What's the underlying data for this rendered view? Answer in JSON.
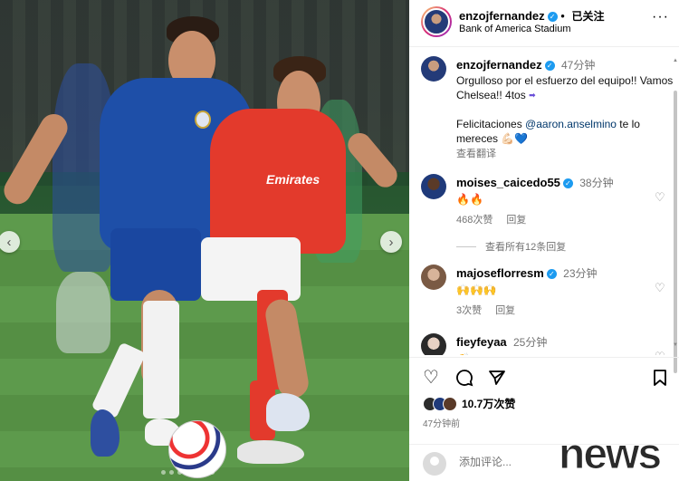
{
  "header": {
    "username": "enzojfernandez",
    "verified_icon": "verified-badge-icon",
    "separator": "•",
    "follow_status": "已关注",
    "location": "Bank of America Stadium",
    "more_icon": "more-horizontal-icon"
  },
  "photo": {
    "sponsor_text": "Emirates",
    "prev_icon": "chevron-left-icon",
    "next_icon": "chevron-right-icon",
    "active_slide": 4,
    "total_slides": 7
  },
  "caption": {
    "username": "enzojfernandez",
    "time": "47分钟",
    "text_line1": "Orgulloso por el esfuerzo del equipo!! Vamos Chelsea!! 4tos",
    "soon_icon": "soon-arrow-icon",
    "text_line2_prefix": "Felicitaciones",
    "mention": "@aaron.anselmino",
    "text_line2_suffix": "te lo mereces",
    "emoji": "💪🏻💙",
    "translate": "查看翻译"
  },
  "comments": [
    {
      "username": "moises_caicedo55",
      "time": "38分钟",
      "text": "🔥🔥",
      "likes": "468次赞",
      "reply": "回复"
    },
    {
      "username": "majoseflorresm",
      "time": "23分钟",
      "text": "🙌🙌🙌",
      "likes": "3次赞",
      "reply": "回复"
    },
    {
      "username": "fieyfeyaa",
      "time": "25分钟",
      "text": "👏",
      "likes": "",
      "reply": ""
    }
  ],
  "view_replies": "查看所有12条回复",
  "actions": {
    "like_icon": "heart-icon",
    "comment_icon": "comment-icon",
    "share_icon": "share-icon",
    "save_icon": "bookmark-icon",
    "likes_count": "10.7万次赞",
    "posted_time": "47分钟前"
  },
  "comment_box": {
    "placeholder": "添加评论..."
  },
  "watermark": "news",
  "colors": {
    "chelsea_blue": "#1e4fa8",
    "benfica_red": "#e33a2c",
    "verified_blue": "#1d9bf0",
    "link_blue": "#00376b",
    "muted_gray": "#737373"
  }
}
